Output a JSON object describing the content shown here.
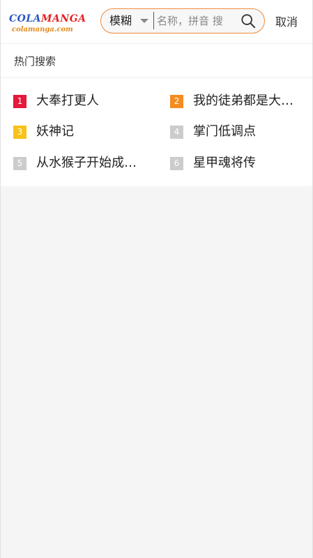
{
  "header": {
    "logo": {
      "part1": "COLA",
      "part2": "MANGA",
      "subtitle": "colamanga.com"
    },
    "search": {
      "mode_label": "模糊",
      "placeholder": "名称，拼音 搜",
      "value": ""
    },
    "cancel_label": "取消"
  },
  "hot_search": {
    "title": "热门搜索",
    "items": [
      {
        "rank": "1",
        "label": "大奉打更人",
        "rank_color": "#e5193b"
      },
      {
        "rank": "2",
        "label": "我的徒弟都是大…",
        "rank_color": "#f58c1f"
      },
      {
        "rank": "3",
        "label": "妖神记",
        "rank_color": "#f8c21a"
      },
      {
        "rank": "4",
        "label": "掌门低调点",
        "rank_color": "#cccccc"
      },
      {
        "rank": "5",
        "label": "从水猴子开始成…",
        "rank_color": "#cccccc"
      },
      {
        "rank": "6",
        "label": "星甲魂将传",
        "rank_color": "#cccccc"
      }
    ]
  },
  "colors": {
    "accent": "#f08a3c",
    "background": "#f5f5f5"
  }
}
